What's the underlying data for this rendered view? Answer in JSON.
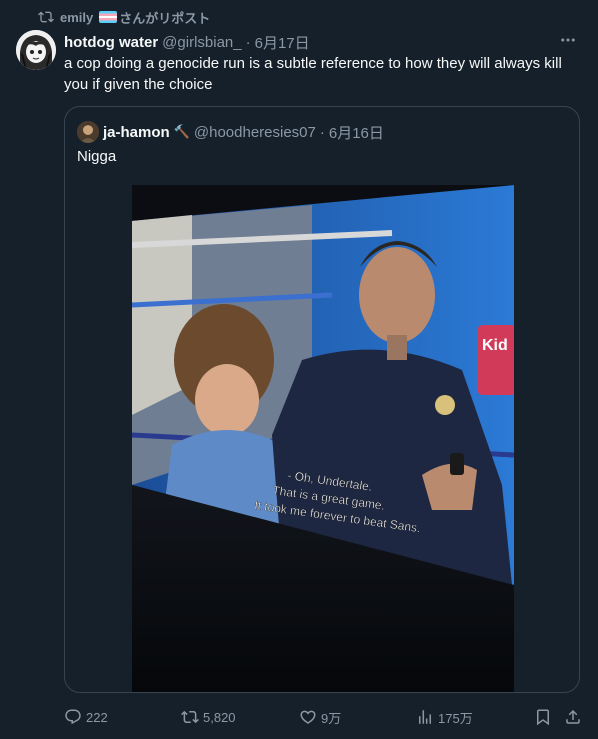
{
  "repost": {
    "user": "emily",
    "label": "さんがリポスト",
    "icon": "repost-icon"
  },
  "post": {
    "display_name": "hotdog water",
    "handle": "@girlsbian_",
    "separator": "·",
    "date": "6月17日",
    "text": "a cop doing a genocide run is a subtle reference to how they will always kill you if given the choice",
    "more_icon": "more-icon"
  },
  "quote": {
    "display_name": "ja-hamon",
    "name_emoji": "🔨",
    "handle": "@hoodheresies07",
    "separator": "·",
    "date": "6月16日",
    "text": "Nigga",
    "image": {
      "subtitle_lines": [
        "- Oh, Undertale.",
        "That is a great game.",
        "It took me forever to beat Sans."
      ],
      "sign_text": "Kid"
    }
  },
  "actions": {
    "replies": "222",
    "reposts": "5,820",
    "likes": "9万",
    "views": "175万"
  },
  "colors": {
    "background": "#15202b",
    "text": "#f7f9f9",
    "secondary": "#8b98a5",
    "border": "#38444d"
  }
}
